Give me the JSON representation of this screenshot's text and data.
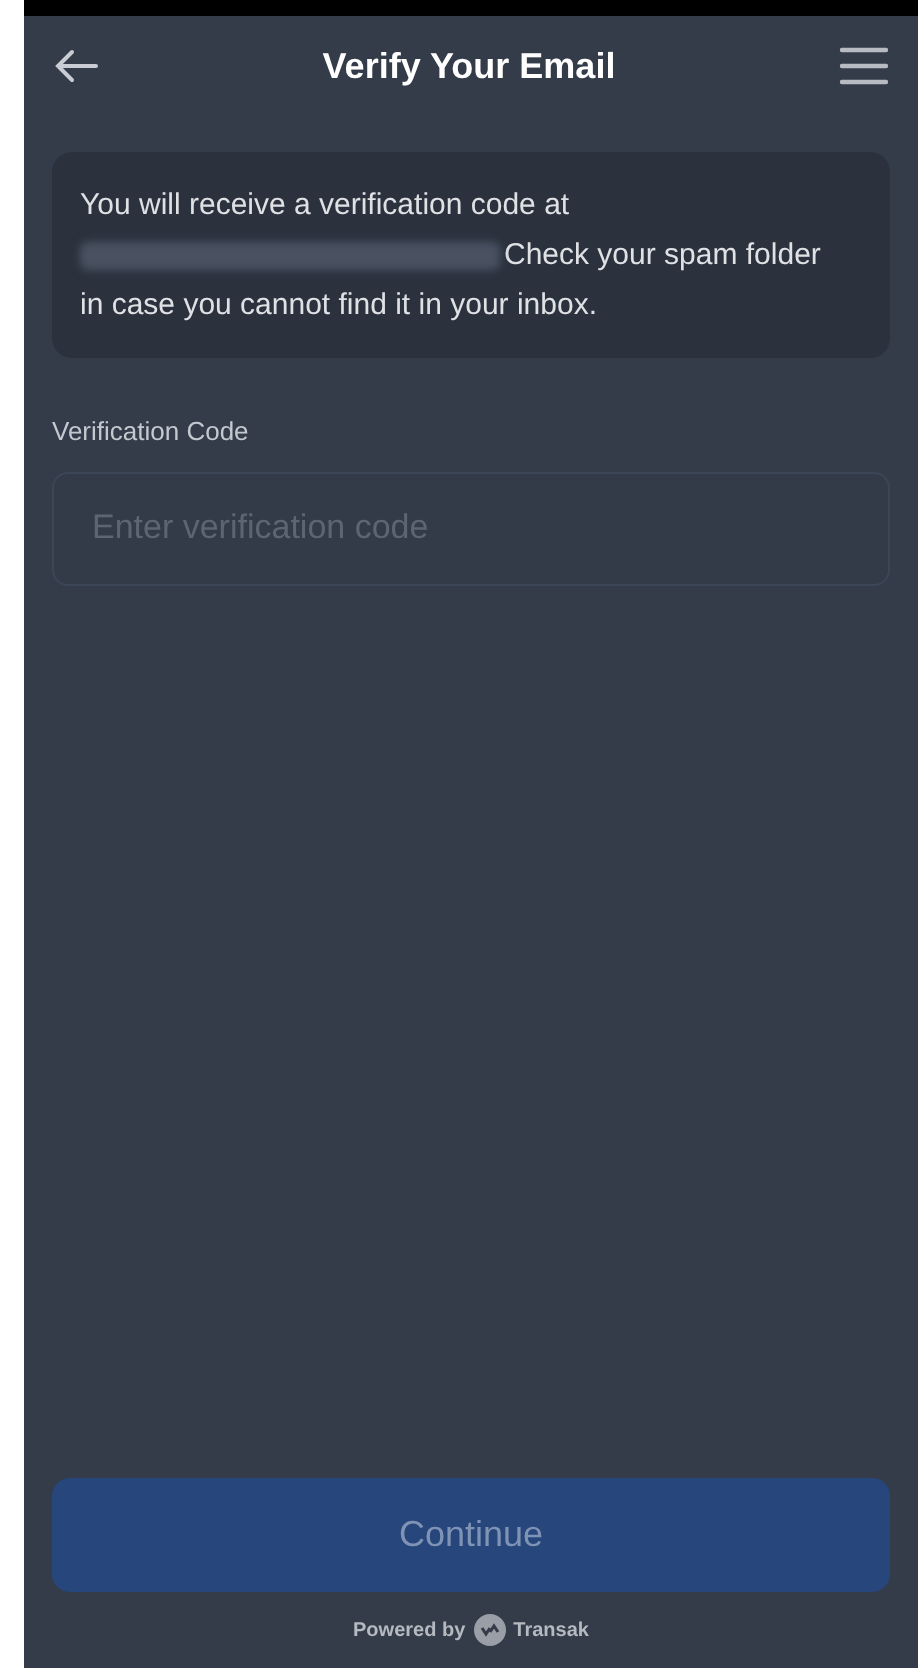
{
  "header": {
    "title": "Verify Your Email"
  },
  "notice": {
    "before": "You will receive a verification code at",
    "after": "Check your spam folder",
    "last_line": "in case you cannot find it in your inbox."
  },
  "code_field": {
    "label": "Verification Code",
    "placeholder": "Enter verification code"
  },
  "continue_button": {
    "label": "Continue",
    "disabled": true
  },
  "footer": {
    "prefix": "Powered by",
    "brand": "Transak"
  }
}
